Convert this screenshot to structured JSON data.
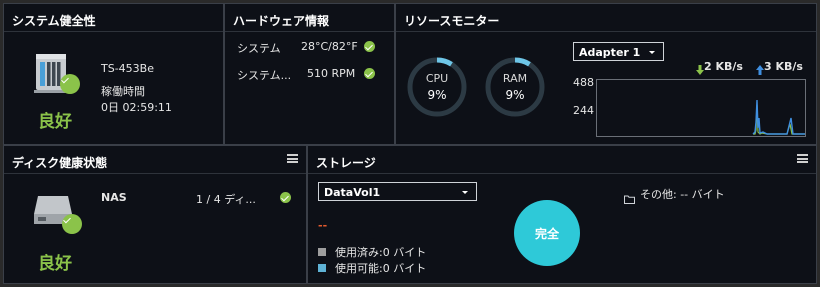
{
  "system_health": {
    "title": "システム健全性",
    "model": "TS-453Be",
    "uptime_label": "稼働時間",
    "uptime_value": "0日 02:59:11",
    "status": "良好"
  },
  "hardware": {
    "title": "ハードウェア情報",
    "rows": [
      {
        "label": "システム",
        "value": "28°C/82°F"
      },
      {
        "label": "システム...",
        "value": "510 RPM"
      }
    ]
  },
  "resource_monitor": {
    "title": "リソースモニター",
    "cpu": {
      "label": "CPU",
      "value": "9%",
      "percent": 9
    },
    "ram": {
      "label": "RAM",
      "value": "9%",
      "percent": 9
    },
    "adapter": "Adapter 1",
    "download": "2 KB/s",
    "upload": "3 KB/s",
    "y_ticks": [
      "488",
      "244"
    ],
    "colors": {
      "download": "#8bc34a",
      "upload": "#3f8fe0",
      "gauge_track": "#2c3a44",
      "gauge_fill": "#6ec6e8"
    }
  },
  "disk_health": {
    "title": "ディスク健康状態",
    "device": "NAS",
    "count": "1 / 4 ディ...",
    "status": "良好"
  },
  "storage": {
    "title": "ストレージ",
    "volume": "DataVol1",
    "other": "その他: -- バイト",
    "dash": "--",
    "used": "使用済み:0 バイト",
    "available": "使用可能:0 バイト",
    "state": "完全",
    "colors": {
      "dash": "#e35a2e",
      "used": "#9e9e9e",
      "available": "#5fb3d6",
      "circle": "#2ec9d8"
    }
  }
}
